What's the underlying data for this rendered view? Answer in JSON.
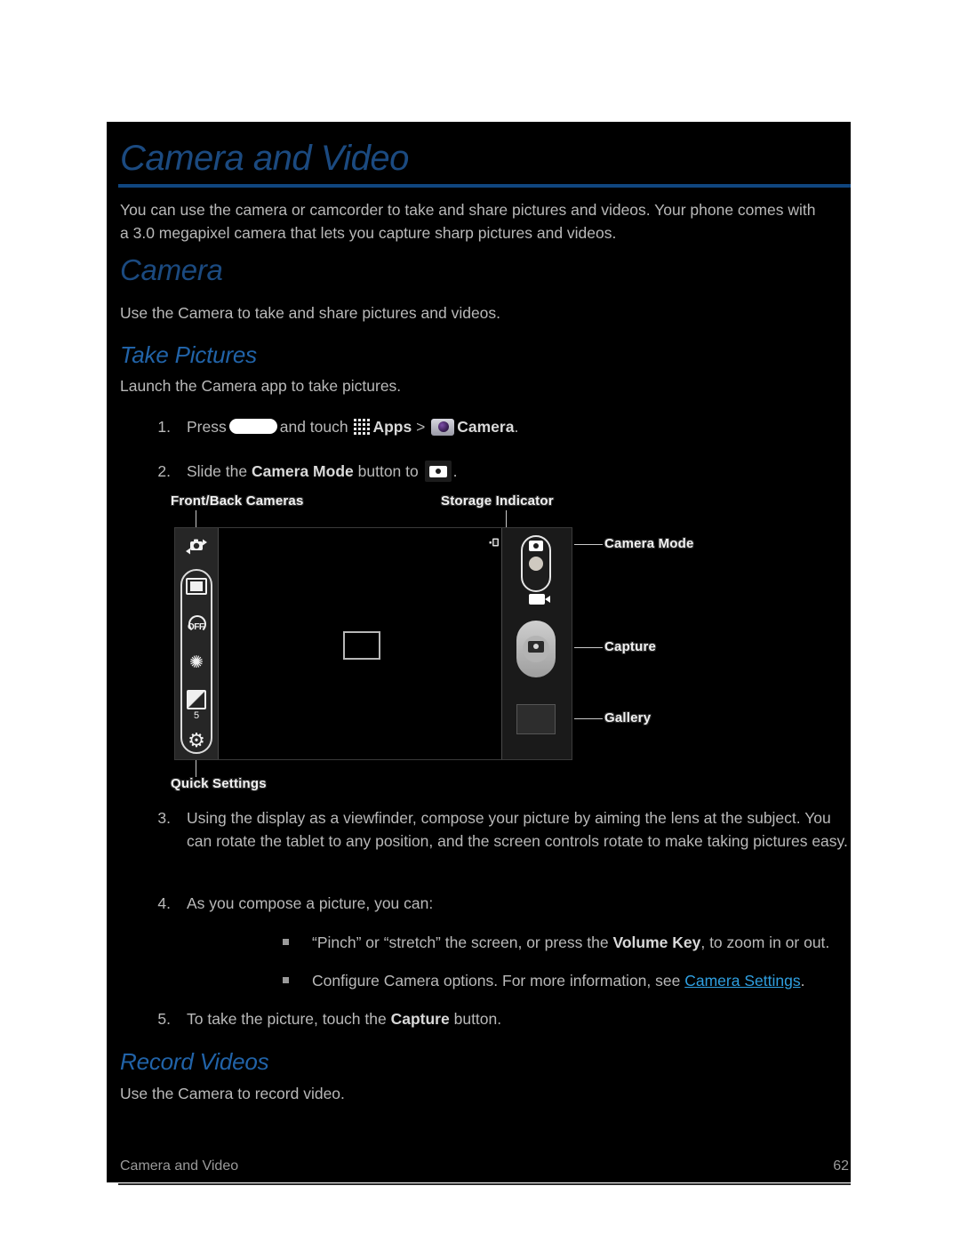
{
  "page": {
    "title": "Camera and Video",
    "intro": "You can use the camera or camcorder to take and share pictures and videos. Your phone comes with a 3.0 megapixel camera that lets you capture sharp pictures and videos."
  },
  "sections": {
    "camera": {
      "heading": "Camera",
      "description": "Use the Camera to take and share pictures and videos."
    },
    "take_pictures": {
      "heading": "Take Pictures",
      "description": "Launch the Camera app to take pictures.",
      "steps": [
        {
          "num": "1.",
          "pre": "Press",
          "mid": "and touch",
          "apps_label": "Apps",
          "separator": ">",
          "camera_label": "Camera",
          "post": "."
        },
        {
          "num": "2.",
          "pre": "Slide the",
          "bold": "Camera Mode",
          "mid": "button to",
          "post": "."
        },
        {
          "num": "3.",
          "text": "Using the display as a viewfinder, compose your picture by aiming the lens at the subject. You can rotate the tablet to any position, and the screen controls rotate to make taking pictures easy."
        },
        {
          "num": "4.",
          "text": "As you compose a picture, you can:"
        },
        {
          "num": "5.",
          "pre": "To take the picture, touch the",
          "bold": "Capture",
          "post": "button."
        }
      ],
      "bullets": [
        {
          "pre": "“Pinch” or “stretch” the screen, or press the",
          "bold": "Volume Key",
          "post": ", to zoom in or out."
        },
        {
          "pre": "Configure Camera options. For more information, see",
          "link": "Camera Settings",
          "post": "."
        }
      ]
    },
    "record_videos": {
      "heading": "Record Videos",
      "description": "Use the Camera to record video."
    }
  },
  "figure": {
    "callouts": {
      "front_back_cameras": "Front/Back Cameras",
      "storage_indicator": "Storage Indicator",
      "camera_mode": "Camera Mode",
      "capture": "Capture",
      "gallery": "Gallery",
      "quick_settings": "Quick Settings"
    },
    "strip_icons": {
      "resolution": "resolution-icon",
      "timer_label": "OFF",
      "effects": "✺",
      "exposure_value": "5",
      "settings": "⚙"
    }
  },
  "footer": {
    "title": "Camera and Video",
    "page_number": "62"
  },
  "colors": {
    "panel_background": "#000000",
    "heading_blue": "#1b4a80",
    "subheading_blue": "#2163a8",
    "rule_blue": "#10467f",
    "body_text": "#b9b9b9",
    "link_blue": "#2f9fe0"
  }
}
